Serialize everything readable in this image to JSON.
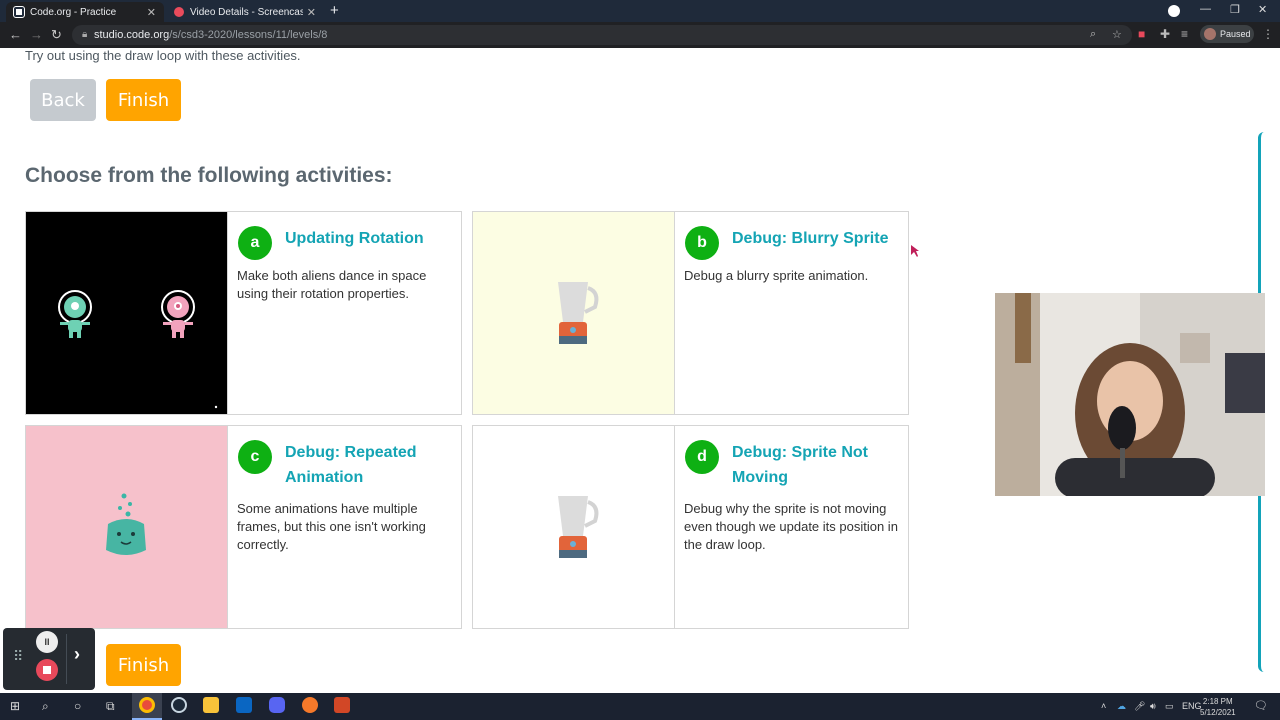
{
  "browser": {
    "tabs": [
      {
        "title": "Code.org - Practice",
        "active": true
      },
      {
        "title": "Video Details - Screencastify",
        "active": false
      }
    ],
    "new_tab_glyph": "+",
    "url_host": "studio.code.org",
    "url_path": "/s/csd3-2020/lessons/11/levels/8",
    "profile_status": "Paused",
    "accent_color": "#8ab4f8"
  },
  "page": {
    "intro_text": "Try out using the draw loop with these activities.",
    "back_label": "Back",
    "finish_label": "Finish",
    "heading": "Choose from the following activities:",
    "colors": {
      "finish": "#ffa400",
      "back": "#c5cacf",
      "title": "#14a4b4",
      "badge": "#0eb013"
    },
    "activities": [
      {
        "letter": "a",
        "title": "Updating Rotation",
        "description": "Make both aliens dance in space using their rotation properties.",
        "thumbnail": "two-aliens-space"
      },
      {
        "letter": "b",
        "title": "Debug: Blurry Sprite",
        "description": "Debug a blurry sprite animation.",
        "thumbnail": "blender"
      },
      {
        "letter": "c",
        "title": "Debug: Repeated Animation",
        "description": "Some animations have multiple frames, but this one isn't working correctly.",
        "thumbnail": "teal-blob"
      },
      {
        "letter": "d",
        "title": "Debug: Sprite Not Moving",
        "description": "Debug why the sprite is not moving even though we update its position in the draw loop.",
        "thumbnail": "blender"
      }
    ]
  },
  "recorder": {
    "pause_glyph": "II",
    "arrow_glyph": "›"
  },
  "taskbar": {
    "language": "ENG",
    "time": "2:18 PM",
    "date": "5/12/2021"
  }
}
